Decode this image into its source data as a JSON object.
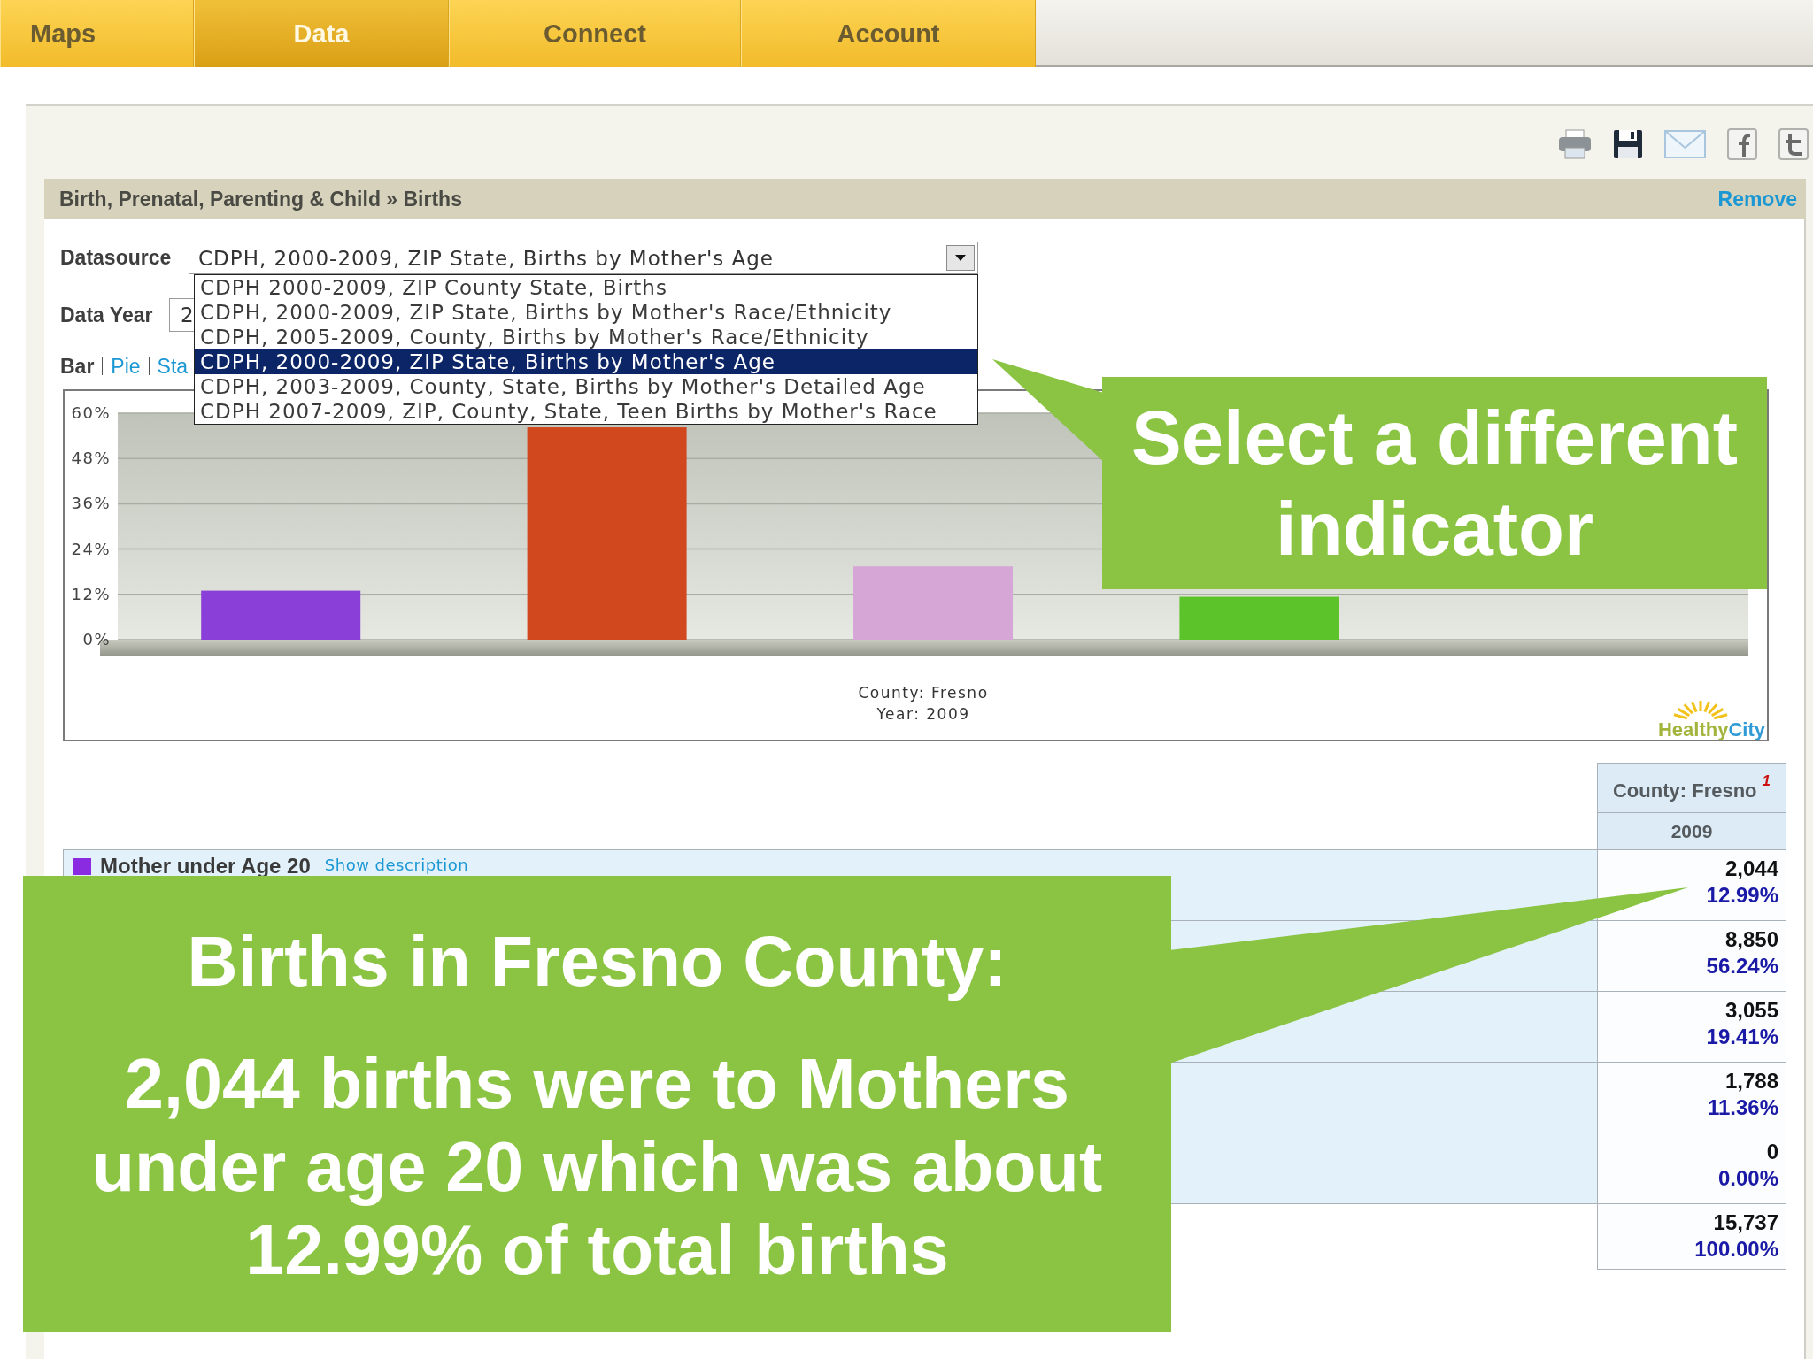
{
  "nav": {
    "tabs": [
      {
        "label": "Maps",
        "selected": false
      },
      {
        "label": "Data",
        "selected": true
      },
      {
        "label": "Connect",
        "selected": false
      },
      {
        "label": "Account",
        "selected": false
      }
    ]
  },
  "section": {
    "title": "Birth, Prenatal, Parenting & Child » Births",
    "remove_link": "Remove"
  },
  "datasource": {
    "label": "Datasource",
    "value": "CDPH, 2000-2009, ZIP State, Births by Mother's Age",
    "options": [
      {
        "label": "CDPH 2000-2009, ZIP County State, Births",
        "selected": false
      },
      {
        "label": "CDPH, 2000-2009, ZIP State, Births by Mother's Race/Ethnicity",
        "selected": false
      },
      {
        "label": "CDPH, 2005-2009, County, Births by Mother's Race/Ethnicity",
        "selected": false
      },
      {
        "label": "CDPH, 2000-2009, ZIP State, Births by Mother's Age",
        "selected": true
      },
      {
        "label": "CDPH, 2003-2009, County, State, Births by Mother's Detailed Age",
        "selected": false
      },
      {
        "label": "CDPH 2007-2009, ZIP, County, State, Teen Births by Mother's Race",
        "selected": false
      }
    ]
  },
  "data_year": {
    "label": "Data Year",
    "value": "2"
  },
  "chart_types": [
    {
      "label": "Bar",
      "selected": true
    },
    {
      "label": "Pie",
      "selected": false
    },
    {
      "label": "Sta",
      "selected": false
    }
  ],
  "chart": {
    "chart_data": {
      "type": "bar",
      "categories": [
        null,
        null,
        null,
        null,
        null
      ],
      "values": [
        12.99,
        56.24,
        19.41,
        11.36,
        0
      ],
      "colors": [
        "#8a40d8",
        "#d2481e",
        "#d6a6d6",
        "#5cc42a",
        "#e6a070"
      ],
      "ylim": [
        0,
        60
      ],
      "yticks": [
        {
          "value": 0,
          "label": "0%"
        },
        {
          "value": 12,
          "label": "12%"
        },
        {
          "value": 24,
          "label": "24%"
        },
        {
          "value": 36,
          "label": "36%"
        },
        {
          "value": 48,
          "label": "48%"
        },
        {
          "value": 60,
          "label": "60%"
        }
      ],
      "grid": true,
      "xlabel": "County: Fresno",
      "annotations": [
        "Year: 2009"
      ]
    },
    "logo": [
      "Healthy",
      "City"
    ]
  },
  "table": {
    "column": {
      "label": "County: Fresno",
      "footnote": "1",
      "year": "2009"
    },
    "rows": [
      {
        "kind": "category",
        "label": "Mother under Age 20",
        "link": "Show description",
        "color": "#8a2be2",
        "count": "2,044",
        "percent": "12.99%"
      },
      {
        "kind": "category",
        "count": "8,850",
        "percent": "56.24%"
      },
      {
        "kind": "category",
        "count": "3,055",
        "percent": "19.41%"
      },
      {
        "kind": "category",
        "count": "1,788",
        "percent": "11.36%"
      },
      {
        "kind": "category",
        "count": "0",
        "percent": "0.00%"
      },
      {
        "kind": "total",
        "count": "15,737",
        "percent": "100.00%"
      }
    ]
  },
  "callouts": [
    {
      "text": "Select a different indicator"
    },
    {
      "title": "Births in Fresno County:",
      "text": "2,044 births were to Mothers under age 20 which was about 12.99% of total births"
    }
  ]
}
